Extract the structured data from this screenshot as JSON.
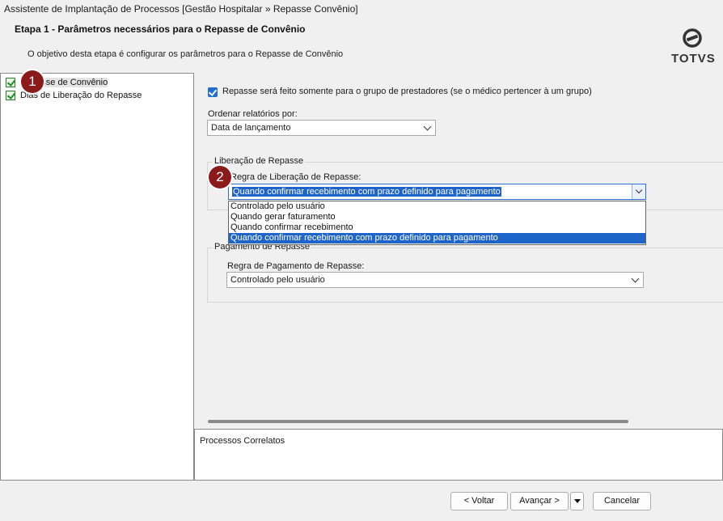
{
  "window": {
    "title": "Assistente de Implantação de Processos [Gestão Hospitalar » Repasse Convênio]"
  },
  "header": {
    "step_title": "Etapa 1 - Parâmetros necessários para o Repasse de Convênio",
    "step_description": "O objetivo desta etapa é configurar os parâmetros para o Repasse de Convênio",
    "logo_text": "TOTVS"
  },
  "tree": {
    "items": [
      {
        "label": "Repasse de Convênio",
        "icon": "green-check-icon",
        "selected": true
      },
      {
        "label": "Dias de Liberação do Repasse",
        "icon": "green-check-icon",
        "selected": false
      }
    ]
  },
  "badges": {
    "first": "1",
    "second": "2",
    "color": "#8b1a1a"
  },
  "form": {
    "group_checkbox_label": "Repasse será feito somente para o grupo de prestadores (se o médico pertencer à um grupo)",
    "group_checkbox_checked": true,
    "order_label": "Ordenar relatórios por:",
    "order_value": "Data de lançamento",
    "liberacao_group_title": "Liberação de Repasse",
    "liberacao_rule_label": "Regra de Liberação de Repasse:",
    "liberacao_rule_value": "Quando confirmar recebimento com prazo definido para pagamento",
    "liberacao_options": [
      "Controlado pelo usuário",
      "Quando gerar faturamento",
      "Quando confirmar recebimento",
      "Quando confirmar recebimento com prazo definido para pagamento"
    ],
    "liberacao_highlighted_index": 3,
    "pagamento_group_title": "Pagamento de Repasse",
    "pagamento_rule_label": "Regra de Pagamento de Repasse:",
    "pagamento_rule_value": "Controlado pelo usuário"
  },
  "bottom": {
    "title": "Processos Correlatos"
  },
  "footer": {
    "back_label": "< Voltar",
    "next_label": "Avançar >",
    "cancel_label": "Cancelar"
  },
  "colors": {
    "accent": "#1f64c8",
    "check_green": "#1b8a1b"
  }
}
